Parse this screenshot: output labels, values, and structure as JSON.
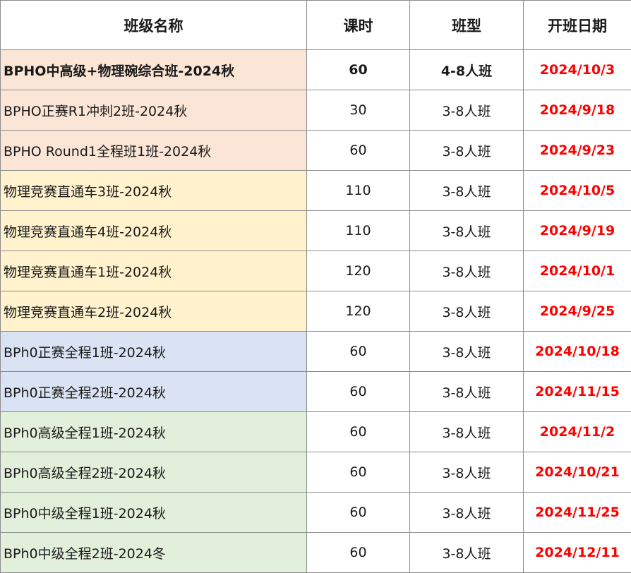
{
  "header": {
    "name": "班级名称",
    "hours": "课时",
    "type": "班型",
    "start_date": "开班日期"
  },
  "colors": {
    "peach": "#fbe5d6",
    "yellow": "#fff2cc",
    "blue": "#dae3f3",
    "green": "#e2efda",
    "date_red": "#ff0000"
  },
  "rows": [
    {
      "name": "BPHO中高级+物理碗综合班-2024秋",
      "hours": "60",
      "type": "4-8人班",
      "date": "2024/10/3"
    },
    {
      "name": "BPHO正赛R1冲刺2班-2024秋",
      "hours": "30",
      "type": "3-8人班",
      "date": "2024/9/18"
    },
    {
      "name": "BPHO Round1全程班1班-2024秋",
      "hours": "60",
      "type": "3-8人班",
      "date": "2024/9/23"
    },
    {
      "name": "物理竞赛直通车3班-2024秋",
      "hours": "110",
      "type": "3-8人班",
      "date": "2024/10/5"
    },
    {
      "name": "物理竞赛直通车4班-2024秋",
      "hours": "110",
      "type": "3-8人班",
      "date": "2024/9/19"
    },
    {
      "name": "物理竞赛直通车1班-2024秋",
      "hours": "120",
      "type": "3-8人班",
      "date": "2024/10/1"
    },
    {
      "name": "物理竞赛直通车2班-2024秋",
      "hours": "120",
      "type": "3-8人班",
      "date": "2024/9/25"
    },
    {
      "name": "BPh0正赛全程1班-2024秋",
      "hours": "60",
      "type": "3-8人班",
      "date": "2024/10/18"
    },
    {
      "name": "BPh0正赛全程2班-2024秋",
      "hours": "60",
      "type": "3-8人班",
      "date": "2024/11/15"
    },
    {
      "name": "BPh0高级全程1班-2024秋",
      "hours": "60",
      "type": "3-8人班",
      "date": "2024/11/2"
    },
    {
      "name": "BPh0高级全程2班-2024秋",
      "hours": "60",
      "type": "3-8人班",
      "date": "2024/10/21"
    },
    {
      "name": "BPh0中级全程1班-2024秋",
      "hours": "60",
      "type": "3-8人班",
      "date": "2024/11/25"
    },
    {
      "name": "BPh0中级全程2班-2024冬",
      "hours": "60",
      "type": "3-8人班",
      "date": "2024/12/11"
    }
  ]
}
